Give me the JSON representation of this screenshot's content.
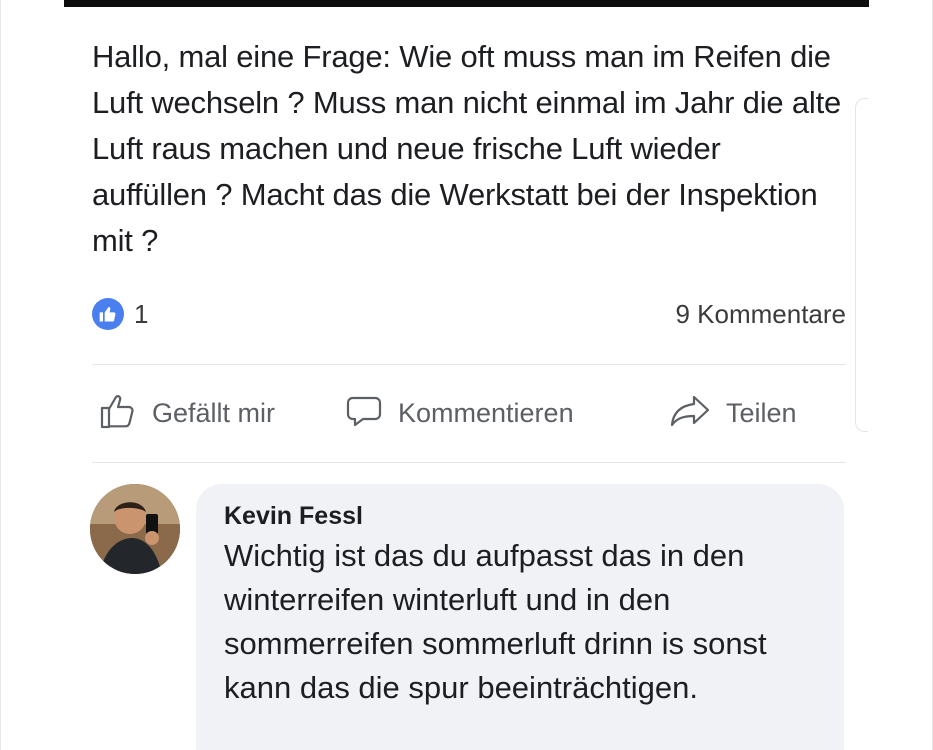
{
  "post": {
    "text": "Hallo, mal eine Frage: Wie oft muss man im Reifen die Luft wechseln ? Muss man nicht einmal im Jahr die alte Luft raus machen und neue frische Luft wieder auffüllen ? Macht das die Werkstatt bei der Inspektion mit ?"
  },
  "reactions": {
    "like_count": "1",
    "comments_count_label": "9 Kommentare",
    "like_badge_color": "#4a7ff0"
  },
  "actions": {
    "like_label": "Gefällt mir",
    "comment_label": "Kommentieren",
    "share_label": "Teilen"
  },
  "comment": {
    "author": "Kevin Fessl",
    "text": "Wichtig ist das du aufpasst das in den winterreifen winterluft und in den sommerreifen sommerluft drinn is sonst kann das die spur beeinträchtigen."
  },
  "icons": {
    "like_badge": "thumbs-up-icon",
    "like_action": "thumbs-up-outline-icon",
    "comment_action": "speech-bubble-icon",
    "share_action": "share-arrow-icon"
  }
}
